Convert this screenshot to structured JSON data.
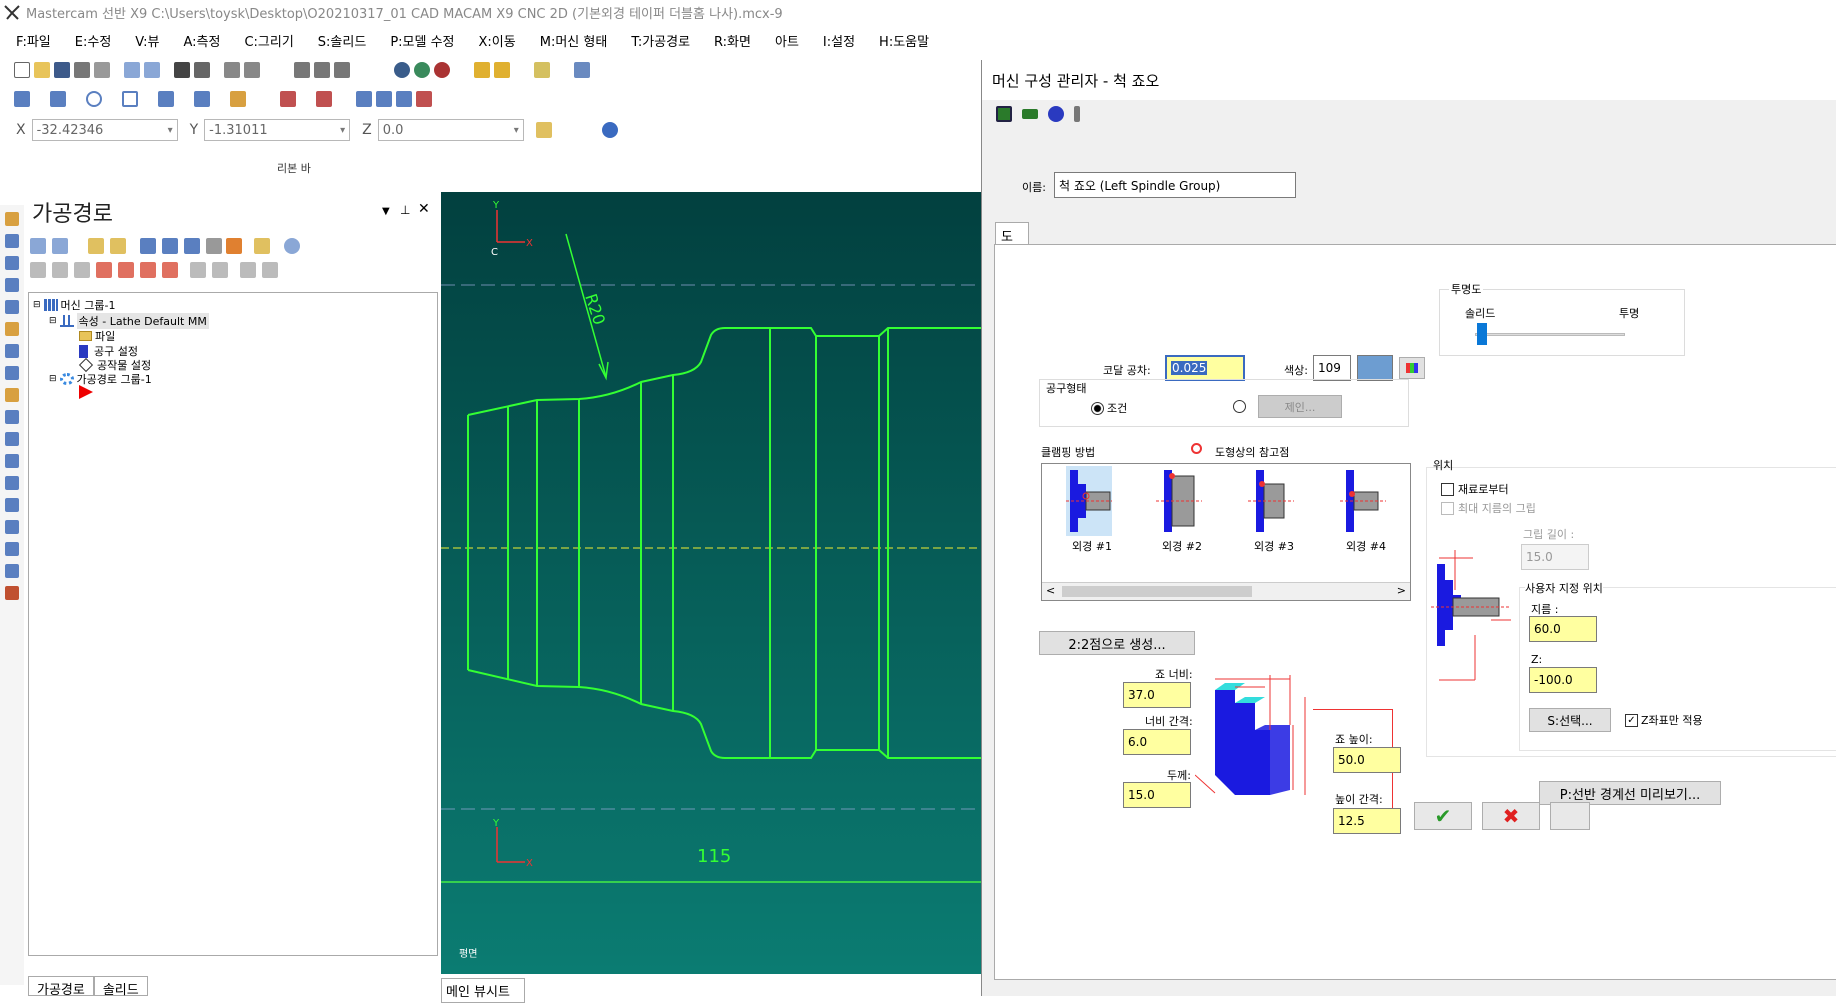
{
  "window": {
    "title": "Mastercam 선반 X9  C:\\Users\\toysk\\Desktop\\O20210317_01 CAD MACAM X9 CNC 2D (기본외경 테이퍼 더블홈 나사).mcx-9"
  },
  "menu": [
    "F:파일",
    "E:수정",
    "V:뷰",
    "A:측정",
    "C:그리기",
    "S:솔리드",
    "P:모델 수정",
    "X:이동",
    "M:머신 형태",
    "T:가공경로",
    "R:화면",
    "아트",
    "I:설정",
    "H:도움말"
  ],
  "coords": {
    "x_label": "X",
    "x_value": "-32.42346",
    "y_label": "Y",
    "y_value": "-1.31011",
    "z_label": "Z",
    "z_value": "0.0"
  },
  "ribbon_label": "리본 바",
  "ops_manager": {
    "title": "가공경로",
    "tree": [
      {
        "label": "머신 그룹-1"
      },
      {
        "label": "속성 - Lathe Default MM"
      },
      {
        "label": "파일"
      },
      {
        "label": "공구 설정"
      },
      {
        "label": "공작물 설정"
      },
      {
        "label": "가공경로 그룹-1"
      }
    ],
    "tabs": [
      "가공경로",
      "솔리드"
    ]
  },
  "viewport": {
    "axis_y": "Y",
    "axis_x": "X",
    "axis_c": "C",
    "radius_label": "R20",
    "length_label": "115",
    "view_label": "평면",
    "tab": "메인 뷰시트"
  },
  "dialog": {
    "title": "머신 구성 관리자 - 척 죠오",
    "name_label": "이름:",
    "name_value": "척 죠오 (Left Spindle Group)",
    "tab": "도형",
    "chord_tol_label": "코달 공차:",
    "chord_tol_value": "0.025",
    "color_label": "색상:",
    "color_value": "109",
    "swatch_color": "#6d9dd1",
    "transparency": {
      "title": "투명도",
      "solid": "솔리드",
      "transparent": "투명",
      "level": 0.02
    },
    "tool_type": {
      "title": "공구형태",
      "opt1": "조건",
      "opt2_button": "제인..."
    },
    "clamping": {
      "title": "클램핑 방법",
      "ref_label": "도형상의 참고점",
      "items": [
        "외경 #1",
        "외경 #2",
        "외경 #3",
        "외경 #4"
      ]
    },
    "position": {
      "title": "위치",
      "from_stock": "재료로부터",
      "max_dia": "최대 지름의 그립",
      "grip_length_label": "그립 길이 :",
      "grip_length_value": "15.0",
      "user_pos_title": "사용자 지정 위치",
      "dia_label": "지름 :",
      "dia_value": "60.0",
      "z_label": "Z:",
      "z_value": "-100.0",
      "select_button": "S:선택...",
      "z_only_label": "Z좌표만 적용"
    },
    "two_point_button": "2:2점으로 생성...",
    "jaw": {
      "width_label": "죠 너비:",
      "width_value": "37.0",
      "step_label": "너비 간격:",
      "step_value": "6.0",
      "thick_label": "두께:",
      "thick_value": "15.0",
      "height_label": "죠 높이:",
      "height_value": "50.0",
      "hstep_label": "높이 간격:",
      "hstep_value": "12.5"
    },
    "preview_button": "P:선반 경계선 미리보기...",
    "ok_icon": "check-icon",
    "cancel_icon": "close-icon"
  }
}
